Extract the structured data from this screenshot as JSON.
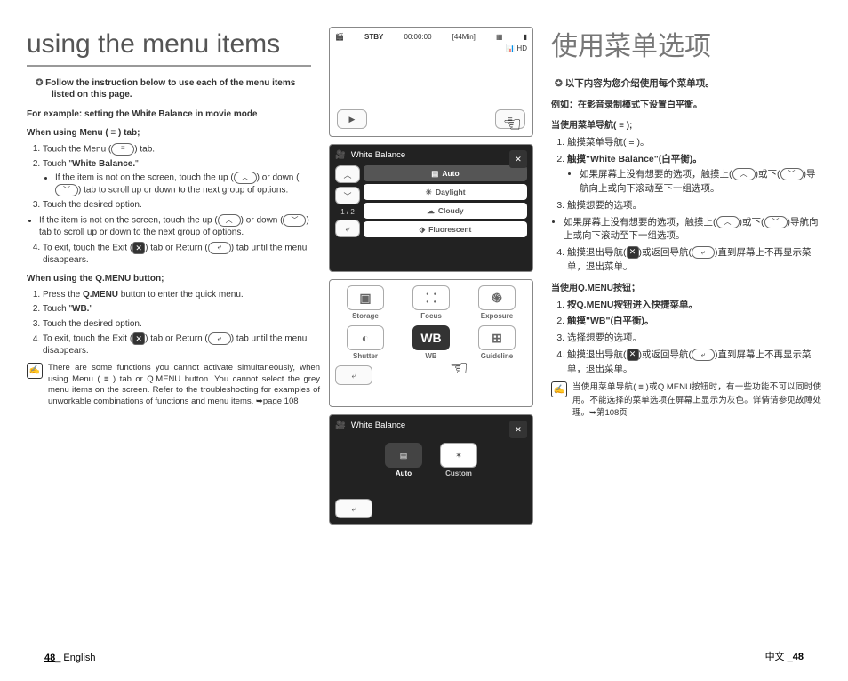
{
  "page_number": "48",
  "english": {
    "title": "using the menu items",
    "lead": "Follow the instruction below to use each of the menu items listed on this page.",
    "example": "For example: setting the White Balance in movie mode",
    "section1_head": "When using Menu ( ≡ ) tab;",
    "s1_1a": "Touch the Menu (",
    "s1_1b": ") tab.",
    "s1_2": "Touch \"",
    "s1_2b": "White Balance.",
    "s1_2c": "\"",
    "s1_bullet1a": "If the item is not on the screen, touch the up (",
    "s1_bullet1b": ") or down (",
    "s1_bullet1c": ") tab to scroll up or down to the next group of options.",
    "s1_3": "Touch the desired option.",
    "s1_4a": "To exit, touch the Exit (",
    "s1_4b": ") tab or Return (",
    "s1_4c": ") tab until the menu disappears.",
    "section2_head": "When using the Q.MENU button;",
    "s2_1a": "Press the ",
    "s2_1b": "Q.MENU",
    "s2_1c": " button to enter the quick menu.",
    "s2_2": "Touch \"",
    "s2_2b": "WB.",
    "s2_2c": "\"",
    "s2_3": "Touch the desired option.",
    "note": "There are some functions you cannot activate simultaneously, when using Menu ( ≡ ) tab or Q.MENU button. You cannot select the grey menu items on the screen. Refer to the troubleshooting for examples of unworkable combinations of functions and menu items. ➥page 108",
    "footer": "_ English"
  },
  "chinese": {
    "title": "使用菜单选项",
    "lead": "以下内容为您介绍使用每个菜单项。",
    "example": "例如：在影音录制模式下设置白平衡。",
    "section1_head": "当使用菜单导航( ≡ );",
    "s1_1": "触摸菜单导航( ≡ )。",
    "s1_2": "触摸\"White Balance\"(白平衡)。",
    "s1_b1a": "如果屏幕上没有想要的选项，触摸上(",
    "s1_b1b": ")或下(",
    "s1_b1c": ")导航向上或向下滚动至下一组选项。",
    "s1_3": "触摸想要的选项。",
    "s1_b2a": "如果屏幕上没有想要的选项，触摸上(",
    "s1_4a": "触摸退出导航(",
    "s1_4b": ")或返回导航(",
    "s1_4c": ")直到屏幕上不再显示菜单，退出菜单。",
    "section2_head": "当使用Q.MENU按钮；",
    "s2_1": "按Q.MENU按钮进入快捷菜单。",
    "s2_2": "触摸\"WB\"(白平衡)。",
    "s2_3": "选择想要的选项。",
    "s2_4a": "触摸退出导航(",
    "s2_4b": ")或返回导航(",
    "s2_4c": ")直到屏幕上不再显示菜单，退出菜单。",
    "note": "当使用菜单导航( ≡ )或Q.MENU按钮时，有一些功能不可以同时使用。不能选择的菜单选项在屏幕上显示为灰色。详情请参见故障处理。➥第108页",
    "footer_a": "中文 _",
    "footer_b": "48"
  },
  "screens": {
    "s1": {
      "stby": "STBY",
      "time": "00:00:00",
      "remain": "[44Min]"
    },
    "wb": {
      "title": "White Balance",
      "auto": "Auto",
      "daylight": "Daylight",
      "cloudy": "Cloudy",
      "fluorescent": "Fluorescent",
      "page": "1 / 2"
    },
    "qmenu": {
      "storage": "Storage",
      "focus": "Focus",
      "exposure": "Exposure",
      "shutter": "Shutter",
      "wb": "WB",
      "guideline": "Guideline"
    },
    "wb2": {
      "title": "White Balance",
      "auto": "Auto",
      "custom": "Custom"
    }
  }
}
